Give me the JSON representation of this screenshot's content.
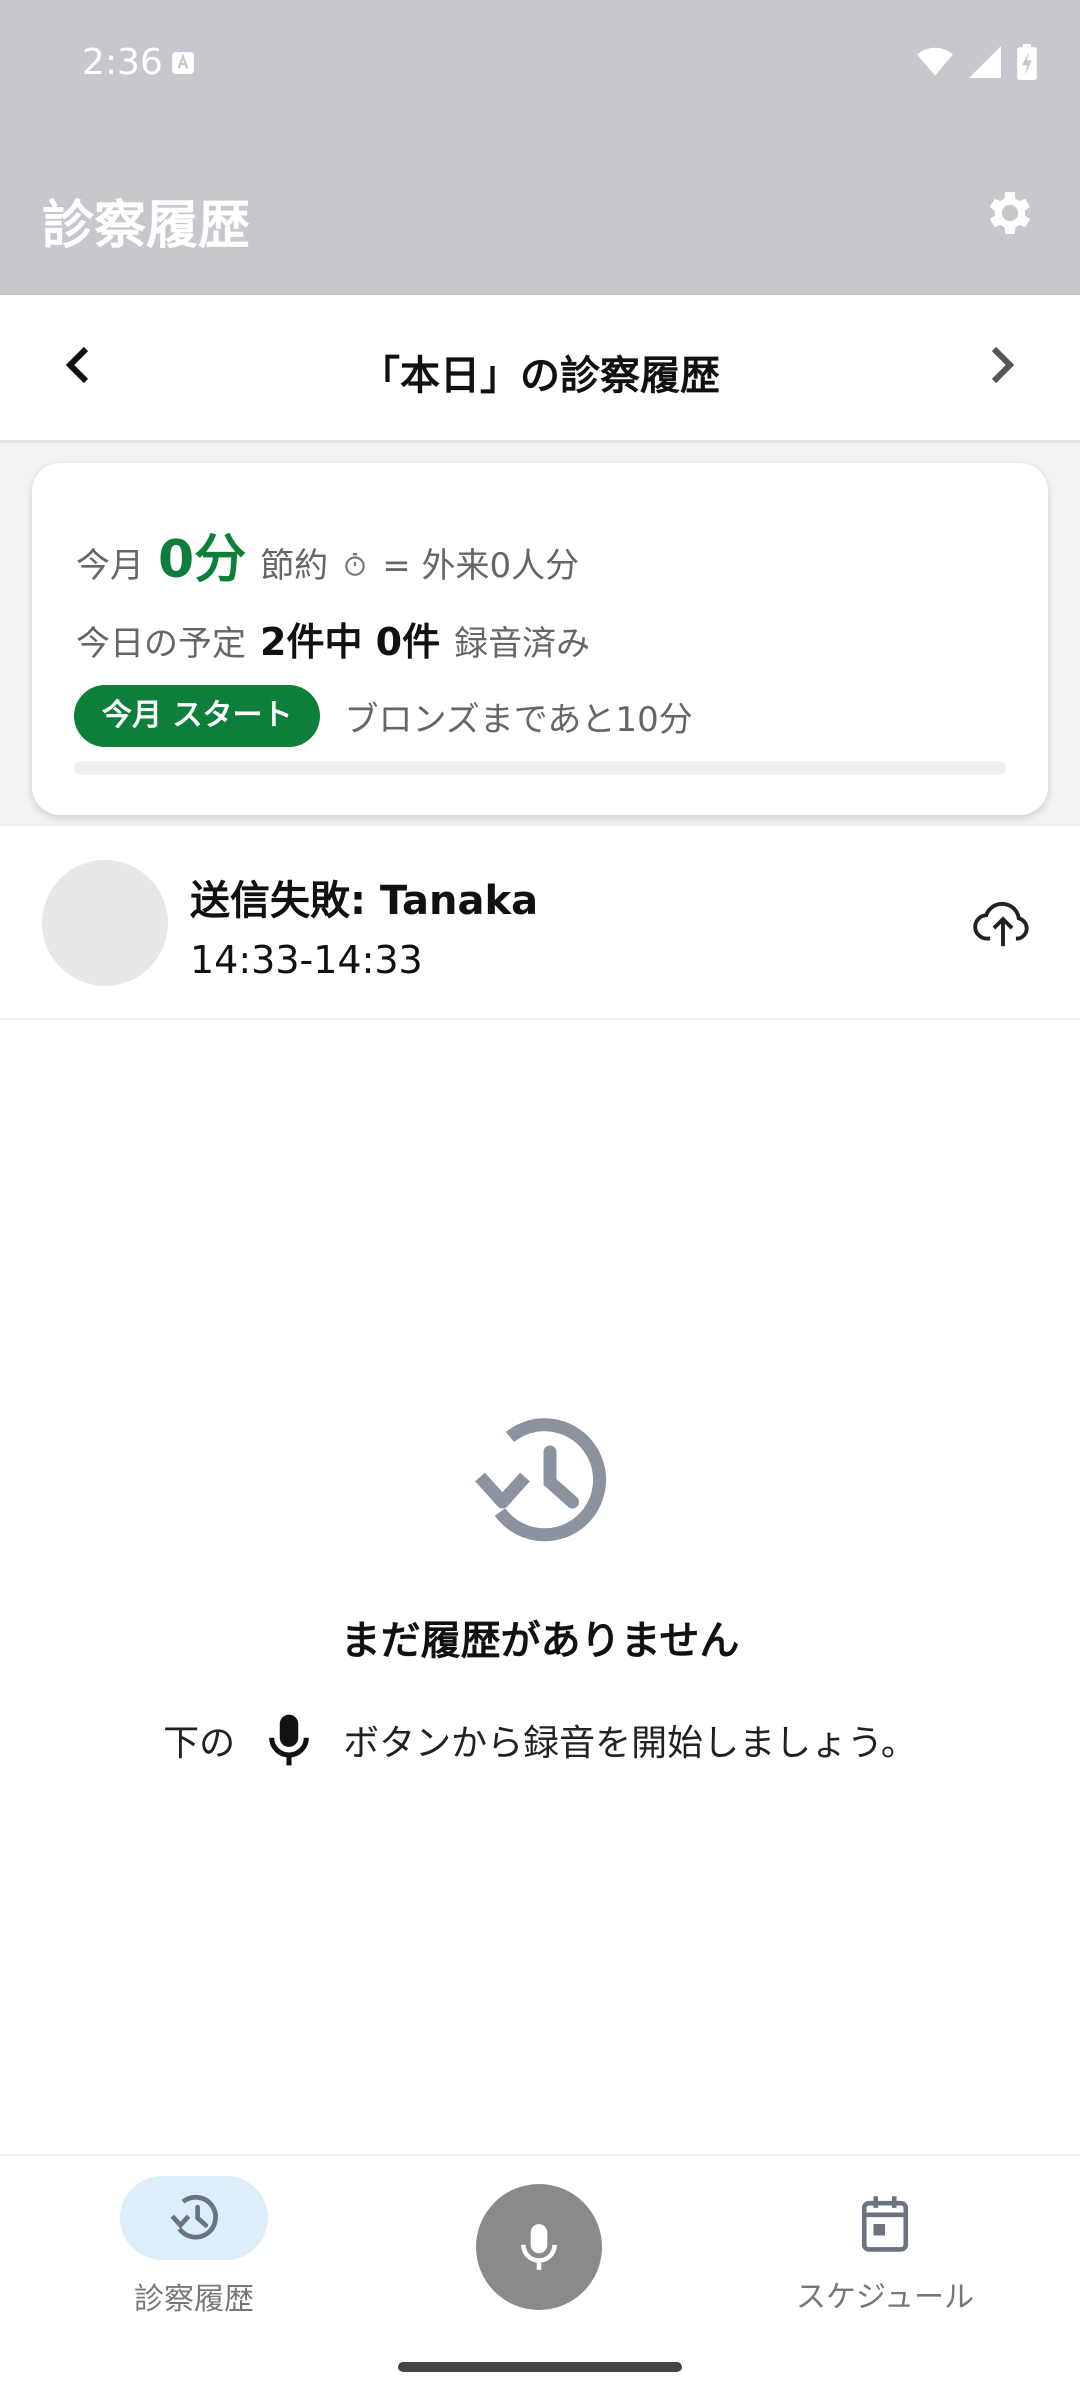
{
  "status_bar": {
    "time": "2:36"
  },
  "app_bar": {
    "title": "診察履歴"
  },
  "date_nav": {
    "title": "「本日」の診察履歴"
  },
  "summary": {
    "month_label": "今月",
    "saved_value": "0分",
    "saved_label": "節約",
    "equivalent_text": "= 外来0人分",
    "today_label": "今日の予定",
    "today_count": "2件中 0件",
    "recorded_label": "録音済み",
    "badge_text": "今月 スタート",
    "next_level_text": "ブロンズまであと10分",
    "progress_percent": 0
  },
  "history_item": {
    "title": "送信失敗: Tanaka",
    "time": "14:33-14:33"
  },
  "empty_state": {
    "title": "まだ履歴がありません",
    "hint_before": "下の",
    "hint_after": "ボタンから録音を開始しましょう。"
  },
  "bottom_nav": {
    "history_label": "診察履歴",
    "schedule_label": "スケジュール"
  },
  "colors": {
    "header_bg": "#c6c8cd",
    "accent_green": "#0d7f3a",
    "selected_pill": "#dceef9",
    "fab_gray": "#8a8a8a"
  },
  "icons": {
    "settings": "gear-icon",
    "prev": "chevron-left-icon",
    "next": "chevron-right-icon",
    "timer": "stopwatch-icon",
    "upload": "cloud-upload-icon",
    "empty": "history-icon",
    "mic": "microphone-icon",
    "schedule": "calendar-icon"
  }
}
